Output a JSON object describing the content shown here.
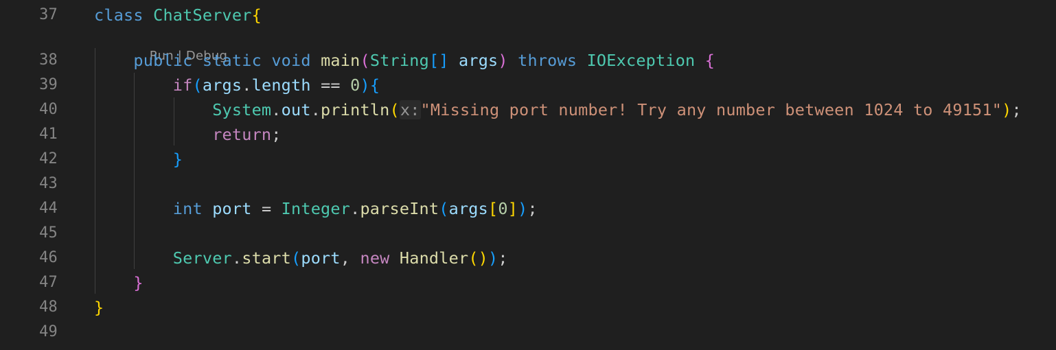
{
  "codelens": {
    "run": "Run",
    "separator": " | ",
    "debug": "Debug"
  },
  "lines": [
    {
      "number": "37",
      "tokens": [
        {
          "t": "class",
          "c": "kw-blue"
        },
        {
          "t": " ",
          "c": "punc"
        },
        {
          "t": "ChatServer",
          "c": "type"
        },
        {
          "t": "{",
          "c": "b1"
        }
      ]
    },
    {
      "number": "38",
      "tokens": [
        {
          "t": "    ",
          "c": "punc"
        },
        {
          "t": "public",
          "c": "kw-blue"
        },
        {
          "t": " ",
          "c": "punc"
        },
        {
          "t": "static",
          "c": "kw-blue"
        },
        {
          "t": " ",
          "c": "punc"
        },
        {
          "t": "void",
          "c": "kw-blue"
        },
        {
          "t": " ",
          "c": "punc"
        },
        {
          "t": "main",
          "c": "fn"
        },
        {
          "t": "(",
          "c": "b2"
        },
        {
          "t": "String",
          "c": "type"
        },
        {
          "t": "[]",
          "c": "b3"
        },
        {
          "t": " ",
          "c": "punc"
        },
        {
          "t": "args",
          "c": "var"
        },
        {
          "t": ")",
          "c": "b2"
        },
        {
          "t": " ",
          "c": "punc"
        },
        {
          "t": "throws",
          "c": "kw-blue"
        },
        {
          "t": " ",
          "c": "punc"
        },
        {
          "t": "IOException",
          "c": "type"
        },
        {
          "t": " ",
          "c": "punc"
        },
        {
          "t": "{",
          "c": "b2"
        }
      ]
    },
    {
      "number": "39",
      "tokens": [
        {
          "t": "        ",
          "c": "punc"
        },
        {
          "t": "if",
          "c": "kw-purple"
        },
        {
          "t": "(",
          "c": "b3"
        },
        {
          "t": "args",
          "c": "var"
        },
        {
          "t": ".",
          "c": "punc"
        },
        {
          "t": "length",
          "c": "var"
        },
        {
          "t": " == ",
          "c": "punc"
        },
        {
          "t": "0",
          "c": "num"
        },
        {
          "t": ")",
          "c": "b3"
        },
        {
          "t": "{",
          "c": "b3"
        }
      ]
    },
    {
      "number": "40",
      "tokens": [
        {
          "t": "            ",
          "c": "punc"
        },
        {
          "t": "System",
          "c": "type"
        },
        {
          "t": ".",
          "c": "punc"
        },
        {
          "t": "out",
          "c": "var"
        },
        {
          "t": ".",
          "c": "punc"
        },
        {
          "t": "println",
          "c": "fn"
        },
        {
          "t": "(",
          "c": "b1"
        },
        {
          "t": "x:",
          "c": "hint"
        },
        {
          "t": "\"Missing port number! Try any number between 1024 to 49151\"",
          "c": "str"
        },
        {
          "t": ")",
          "c": "b1"
        },
        {
          "t": ";",
          "c": "punc"
        }
      ]
    },
    {
      "number": "41",
      "tokens": [
        {
          "t": "            ",
          "c": "punc"
        },
        {
          "t": "return",
          "c": "kw-purple"
        },
        {
          "t": ";",
          "c": "punc"
        }
      ]
    },
    {
      "number": "42",
      "tokens": [
        {
          "t": "        ",
          "c": "punc"
        },
        {
          "t": "}",
          "c": "b3"
        }
      ]
    },
    {
      "number": "43",
      "tokens": []
    },
    {
      "number": "44",
      "tokens": [
        {
          "t": "        ",
          "c": "punc"
        },
        {
          "t": "int",
          "c": "kw-blue"
        },
        {
          "t": " ",
          "c": "punc"
        },
        {
          "t": "port",
          "c": "var"
        },
        {
          "t": " = ",
          "c": "punc"
        },
        {
          "t": "Integer",
          "c": "type"
        },
        {
          "t": ".",
          "c": "punc"
        },
        {
          "t": "parseInt",
          "c": "fn"
        },
        {
          "t": "(",
          "c": "b3"
        },
        {
          "t": "args",
          "c": "var"
        },
        {
          "t": "[",
          "c": "b1"
        },
        {
          "t": "0",
          "c": "num"
        },
        {
          "t": "]",
          "c": "b1"
        },
        {
          "t": ")",
          "c": "b3"
        },
        {
          "t": ";",
          "c": "punc"
        }
      ]
    },
    {
      "number": "45",
      "tokens": []
    },
    {
      "number": "46",
      "tokens": [
        {
          "t": "        ",
          "c": "punc"
        },
        {
          "t": "Server",
          "c": "type"
        },
        {
          "t": ".",
          "c": "punc"
        },
        {
          "t": "start",
          "c": "fn"
        },
        {
          "t": "(",
          "c": "b3"
        },
        {
          "t": "port",
          "c": "var"
        },
        {
          "t": ", ",
          "c": "punc"
        },
        {
          "t": "new",
          "c": "kw-purple"
        },
        {
          "t": " ",
          "c": "punc"
        },
        {
          "t": "Handler",
          "c": "fn"
        },
        {
          "t": "(",
          "c": "b1"
        },
        {
          "t": ")",
          "c": "b1"
        },
        {
          "t": ")",
          "c": "b3"
        },
        {
          "t": ";",
          "c": "punc"
        }
      ]
    },
    {
      "number": "47",
      "tokens": [
        {
          "t": "    ",
          "c": "punc"
        },
        {
          "t": "}",
          "c": "b2"
        }
      ]
    },
    {
      "number": "48",
      "tokens": [
        {
          "t": "}",
          "c": "b1"
        }
      ]
    },
    {
      "number": "49",
      "tokens": []
    }
  ],
  "colors": {
    "background": "#1f1f1f",
    "line_number": "#858585",
    "keyword": "#569cd6",
    "control_keyword": "#c586c0",
    "type": "#4ec9b0",
    "function": "#dcdcaa",
    "variable": "#9cdcfe",
    "string": "#ce9178",
    "number": "#b5cea8"
  }
}
